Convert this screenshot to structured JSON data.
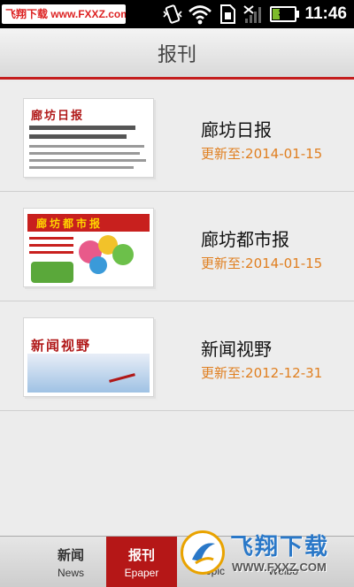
{
  "status_bar": {
    "watermark": "飞翔下载 www.FXXZ.com",
    "battery_level": "30",
    "time": "11:46"
  },
  "header": {
    "title": "报刊"
  },
  "papers": [
    {
      "name": "廊坊日报",
      "update": "更新至:2014-01-15",
      "masthead": "廊坊日报"
    },
    {
      "name": "廊坊都市报",
      "update": "更新至:2014-01-15",
      "masthead": "廊坊都市报"
    },
    {
      "name": "新闻视野",
      "update": "更新至:2012-12-31",
      "masthead": "新闻视野"
    }
  ],
  "tabs": [
    {
      "cn": "新闻",
      "en": "News",
      "active": false
    },
    {
      "cn": "报刊",
      "en": "Epaper",
      "active": true
    },
    {
      "cn": "",
      "en": "Topic",
      "active": false
    },
    {
      "cn": "",
      "en": "Weibo",
      "active": false
    }
  ],
  "bottom_watermark": {
    "title": "飞翔下载",
    "url": "WWW.FXXZ.COM"
  },
  "colors": {
    "accent": "#c41d1d",
    "update_text": "#e07f20"
  }
}
